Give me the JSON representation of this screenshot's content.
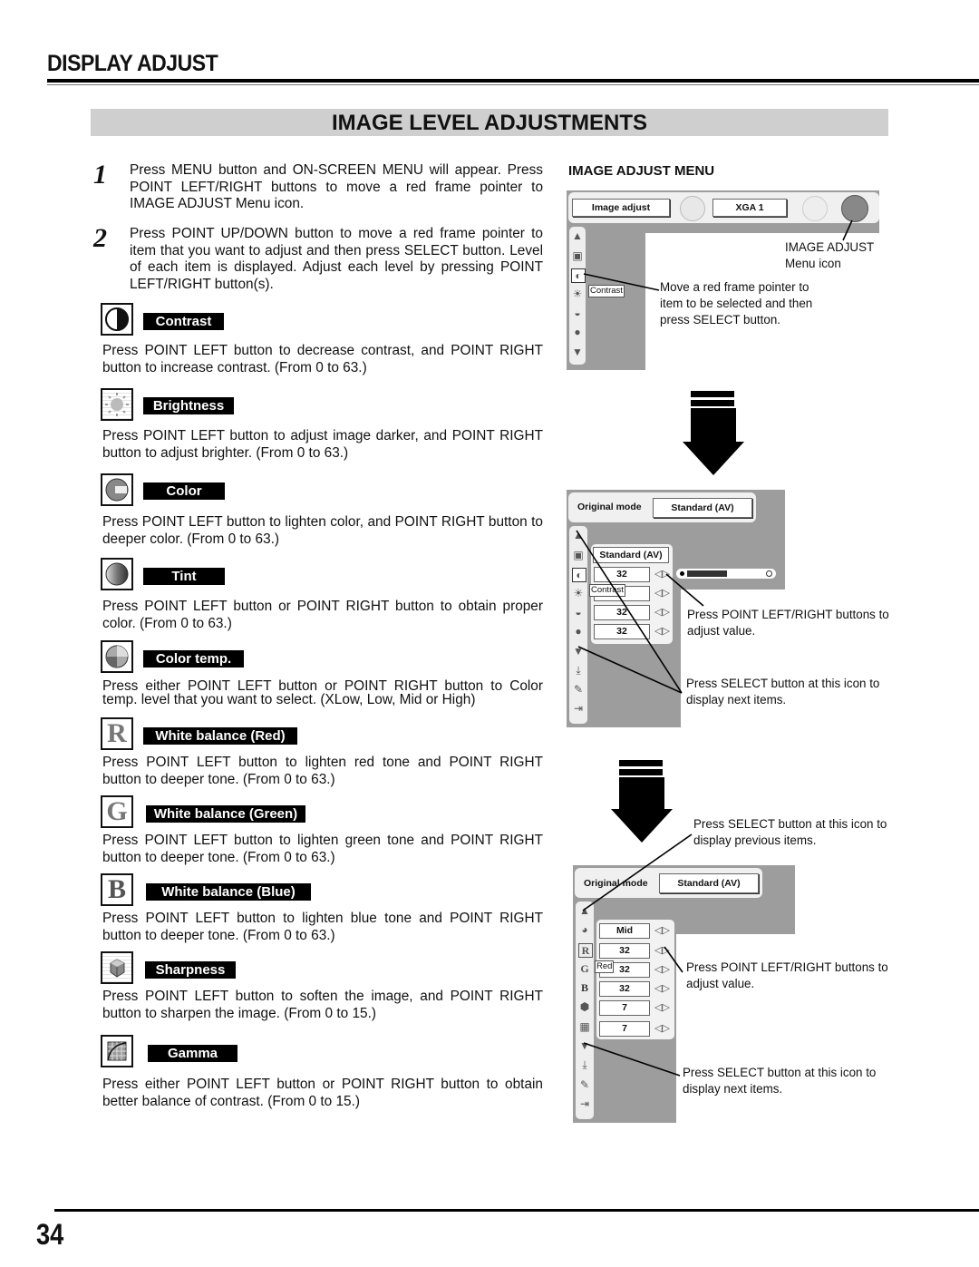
{
  "header": {
    "section_title": "DISPLAY ADJUST",
    "page_title": "IMAGE LEVEL ADJUSTMENTS"
  },
  "steps": [
    {
      "number": "1",
      "text": "Press MENU button and ON-SCREEN MENU will appear.  Press POINT LEFT/RIGHT buttons to move a red frame pointer to IMAGE ADJUST Menu icon."
    },
    {
      "number": "2",
      "text": "Press POINT UP/DOWN button to move a red frame pointer to item that you want to adjust and then press SELECT button. Level of each item is displayed.  Adjust each level by pressing POINT LEFT/RIGHT button(s)."
    }
  ],
  "items": [
    {
      "label": "Contrast",
      "icon": "contrast-icon",
      "text": "Press POINT LEFT button to decrease contrast, and POINT RIGHT button to increase contrast.  (From 0 to 63.)"
    },
    {
      "label": "Brightness",
      "icon": "brightness-icon",
      "text": "Press POINT LEFT button to adjust image darker, and POINT RIGHT button to adjust brighter.  (From 0 to 63.)"
    },
    {
      "label": "Color",
      "icon": "color-icon",
      "text": "Press POINT LEFT button to lighten color, and POINT RIGHT button to deeper color.  (From 0 to 63.)"
    },
    {
      "label": "Tint",
      "icon": "tint-icon",
      "text": "Press POINT LEFT button or POINT RIGHT button to obtain proper color.  (From 0 to 63.)"
    },
    {
      "label": "Color temp.",
      "icon": "color-temp-icon",
      "text": "Press either POINT LEFT button or POINT RIGHT button to Color temp. level that you want to select. (XLow, Low, Mid or High)"
    },
    {
      "label": "White balance (Red)",
      "icon": "white-balance-red-icon",
      "glyph": "R",
      "text": "Press POINT LEFT button to lighten red tone and POINT RIGHT button to deeper tone.  (From 0 to 63.)"
    },
    {
      "label": "White balance (Green)",
      "icon": "white-balance-green-icon",
      "glyph": "G",
      "text": "Press POINT LEFT button to lighten green tone and POINT RIGHT button to deeper tone.  (From 0 to 63.)"
    },
    {
      "label": "White balance (Blue)",
      "icon": "white-balance-blue-icon",
      "glyph": "B",
      "text": "Press POINT LEFT button to lighten blue tone and POINT RIGHT button to deeper tone.  (From 0 to 63.)"
    },
    {
      "label": "Sharpness",
      "icon": "sharpness-icon",
      "text": "Press POINT LEFT button to soften the image, and POINT RIGHT button to sharpen the image.  (From 0 to 15.)"
    },
    {
      "label": "Gamma",
      "icon": "gamma-icon",
      "text": "Press either POINT LEFT button or POINT RIGHT button to obtain better balance of contrast.  (From 0 to 15.)"
    }
  ],
  "right": {
    "heading": "IMAGE ADJUST MENU",
    "osd1": {
      "menu_label": "Image adjust",
      "input_label": "XGA 1",
      "tooltip": "Contrast",
      "callout_icon": "IMAGE ADJUST\nMenu icon",
      "callout_icon_line1": "IMAGE ADJUST",
      "callout_icon_line2": "Menu icon",
      "callout_pointer": "Move a red frame pointer to item to be selected and then press SELECT button."
    },
    "osd2": {
      "mode_label": "Original mode",
      "mode_value": "Standard (AV)",
      "preset": "Standard (AV)",
      "values": [
        "32",
        "",
        "32",
        "32"
      ],
      "tooltip": "Contrast",
      "slider_level": 0.5,
      "callout_adjust": "Press POINT LEFT/RIGHT buttons to adjust value.",
      "callout_next": "Press SELECT button at this icon to display next items."
    },
    "osd3": {
      "mode_label": "Original mode",
      "mode_value": "Standard (AV)",
      "values": [
        "Mid",
        "32",
        "32",
        "32",
        "7",
        "7"
      ],
      "tooltip": "Red",
      "callout_prev": "Press SELECT button at this icon to display previous items.",
      "callout_adjust": "Press POINT LEFT/RIGHT buttons to adjust value.",
      "callout_next": "Press SELECT button at this icon to display next items."
    }
  },
  "footer": {
    "page_number": "34"
  }
}
